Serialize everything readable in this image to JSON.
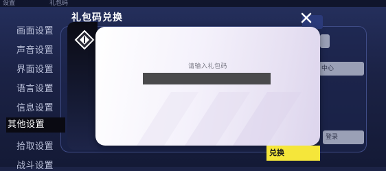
{
  "top_bar": {
    "left_text": "设置",
    "right_text": "礼包码"
  },
  "side_menu": {
    "items": [
      {
        "label": "画面设置",
        "active": false
      },
      {
        "label": "声音设置",
        "active": false
      },
      {
        "label": "界面设置",
        "active": false
      },
      {
        "label": "语言设置",
        "active": false
      },
      {
        "label": "信息设置",
        "active": false
      },
      {
        "label": "其他设置",
        "active": true
      },
      {
        "label": "拾取设置",
        "active": false
      },
      {
        "label": "战斗设置",
        "active": false
      }
    ]
  },
  "background_buttons": {
    "center_btn": "中心",
    "bind_btn": "登录"
  },
  "dialog": {
    "title": "礼包码兑换",
    "prompt": "请输入礼包码",
    "input_value": "",
    "redeem_label": "兑换"
  },
  "colors": {
    "accent": "#f5e63a",
    "panel": "#f4f1fb",
    "input": "#4a4a4c"
  },
  "icons": {
    "close": "close-icon",
    "emblem": "gift-diamond-icon"
  }
}
